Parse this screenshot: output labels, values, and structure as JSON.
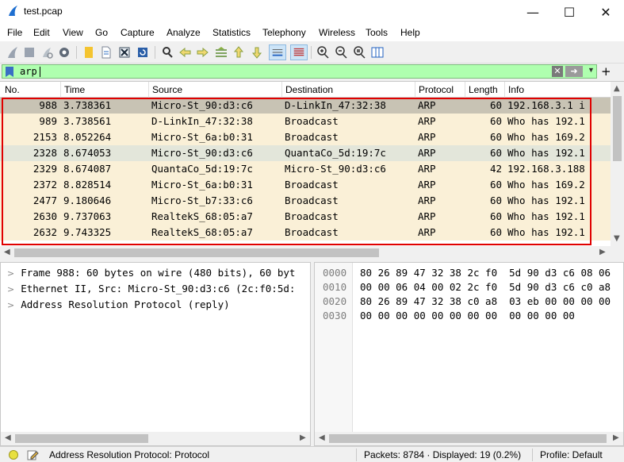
{
  "window": {
    "title": "test.pcap"
  },
  "menu": [
    "File",
    "Edit",
    "View",
    "Go",
    "Capture",
    "Analyze",
    "Statistics",
    "Telephony",
    "Wireless",
    "Tools",
    "Help"
  ],
  "filter": {
    "value": "arp",
    "clear_icon": "clear-icon",
    "apply_icon": "arrow-right-icon"
  },
  "packet_list": {
    "columns": [
      "No.",
      "Time",
      "Source",
      "Destination",
      "Protocol",
      "Length",
      "Info"
    ],
    "rows": [
      {
        "no": "988",
        "time": "3.738361",
        "source": "Micro-St_90:d3:c6",
        "destination": "D-LinkIn_47:32:38",
        "protocol": "ARP",
        "length": "60",
        "info": "192.168.3.1 i",
        "bg": "#c8c3b4"
      },
      {
        "no": "989",
        "time": "3.738561",
        "source": "D-LinkIn_47:32:38",
        "destination": "Broadcast",
        "protocol": "ARP",
        "length": "60",
        "info": "Who has 192.1",
        "bg": "#faf0d7"
      },
      {
        "no": "2153",
        "time": "8.052264",
        "source": "Micro-St_6a:b0:31",
        "destination": "Broadcast",
        "protocol": "ARP",
        "length": "60",
        "info": "Who has 169.2",
        "bg": "#faf0d7"
      },
      {
        "no": "2328",
        "time": "8.674053",
        "source": "Micro-St_90:d3:c6",
        "destination": "QuantaCo_5d:19:7c",
        "protocol": "ARP",
        "length": "60",
        "info": "Who has 192.1",
        "bg": "#e3e6da"
      },
      {
        "no": "2329",
        "time": "8.674087",
        "source": "QuantaCo_5d:19:7c",
        "destination": "Micro-St_90:d3:c6",
        "protocol": "ARP",
        "length": "42",
        "info": "192.168.3.188",
        "bg": "#faf0d7"
      },
      {
        "no": "2372",
        "time": "8.828514",
        "source": "Micro-St_6a:b0:31",
        "destination": "Broadcast",
        "protocol": "ARP",
        "length": "60",
        "info": "Who has 169.2",
        "bg": "#faf0d7"
      },
      {
        "no": "2477",
        "time": "9.180646",
        "source": "Micro-St_b7:33:c6",
        "destination": "Broadcast",
        "protocol": "ARP",
        "length": "60",
        "info": "Who has 192.1",
        "bg": "#faf0d7"
      },
      {
        "no": "2630",
        "time": "9.737063",
        "source": "RealtekS_68:05:a7",
        "destination": "Broadcast",
        "protocol": "ARP",
        "length": "60",
        "info": "Who has 192.1",
        "bg": "#faf0d7"
      },
      {
        "no": "2632",
        "time": "9.743325",
        "source": "RealtekS_68:05:a7",
        "destination": "Broadcast",
        "protocol": "ARP",
        "length": "60",
        "info": "Who has 192.1",
        "bg": "#faf0d7"
      }
    ]
  },
  "details": [
    "Frame 988: 60 bytes on wire (480 bits), 60 byt",
    "Ethernet II, Src: Micro-St_90:d3:c6 (2c:f0:5d:",
    "Address Resolution Protocol (reply)"
  ],
  "bytes": {
    "offsets": [
      "0000",
      "0010",
      "0020",
      "0030"
    ],
    "hex": [
      "80 26 89 47 32 38 2c f0  5d 90 d3 c6 08 06",
      "00 00 06 04 00 02 2c f0  5d 90 d3 c6 c0 a8",
      "80 26 89 47 32 38 c0 a8  03 eb 00 00 00 00",
      "00 00 00 00 00 00 00 00  00 00 00 00"
    ]
  },
  "status": {
    "field": "Address Resolution Protocol: Protocol",
    "packets": "Packets: 8784 · Displayed: 19 (0.2%)",
    "profile": "Profile: Default"
  },
  "colors": {
    "filter_bg": "#afffaf",
    "highlight_border": "#e00000",
    "selected_row": "#c8c3b4"
  }
}
